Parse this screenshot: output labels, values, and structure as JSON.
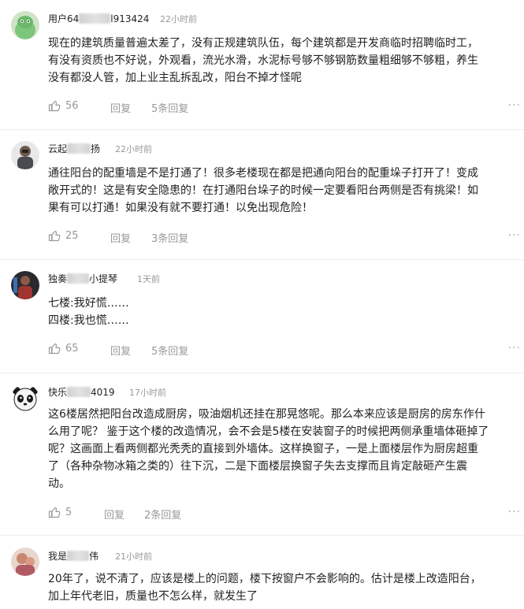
{
  "comments": [
    {
      "user_prefix": "用户64",
      "user_suffix": "l913424",
      "time": "22小时前",
      "lines": [
        "现在的建筑质量普遍太差了，没有正规建筑队伍，每个建筑都是开发商临时招聘临时工，",
        "有没有资质也不好说，外观看，流光水滑，水泥标号够不够钢筋数量粗细够不够粗，养生",
        "没有都没人管，加上业主乱拆乱改，阳台不掉才怪呢"
      ],
      "likes": "56",
      "reply_label": "回复",
      "reply_count": "5条回复"
    },
    {
      "user_prefix": "云起",
      "user_suffix": "扬",
      "time": "22小时前",
      "lines": [
        "通往阳台的配重墙是不是打通了！很多老楼现在都是把通向阳台的配重垛子打开了！变成",
        "敞开式的！这是有安全隐患的！在打通阳台垛子的时候一定要看阳台两侧是否有挑梁！如",
        "果有可以打通！如果没有就不要打通！以免出现危险！"
      ],
      "likes": "25",
      "reply_label": "回复",
      "reply_count": "3条回复"
    },
    {
      "user_prefix": "独奏",
      "user_suffix": "小提琴",
      "time": "1天前",
      "lines": [
        "七楼:我好慌……",
        "四楼:我也慌……"
      ],
      "likes": "65",
      "reply_label": "回复",
      "reply_count": "5条回复"
    },
    {
      "user_prefix": "快乐",
      "user_suffix": "4019",
      "time": "17小时前",
      "lines": [
        "这6楼居然把阳台改造成厨房，吸油烟机还挂在那晃悠呢。那么本来应该是厨房的房东作什",
        "么用了呢？ 鉴于这个楼的改造情况，会不会是5楼在安装窗子的时候把两侧承重墙体砸掉了",
        "呢？这画面上看两侧都光秃秃的直接到外墙体。这样换窗子，一是上面楼层作为厨房超重",
        "了（各种杂物冰箱之类的）往下沉，二是下面楼层换窗子失去支撑而且肯定敲砸产生震",
        "动。"
      ],
      "likes": "5",
      "reply_label": "回复",
      "reply_count": "2条回复"
    },
    {
      "user_prefix": "我是",
      "user_suffix": "伟",
      "time": "21小时前",
      "lines": [
        "20年了，说不清了，应该是楼上的问题，楼下按窗户不会影响的。估计是楼上改造阳台，",
        "加上年代老旧，质量也不怎么样，就发生了"
      ]
    }
  ],
  "more_label": "···",
  "colors": {
    "text": "#222222",
    "meta": "#999999",
    "divider": "#eeeeee"
  }
}
